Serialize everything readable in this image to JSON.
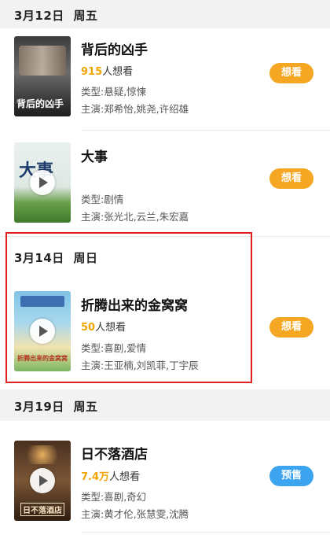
{
  "sections": [
    {
      "date": "3月12日",
      "weekday": "周五",
      "movies": [
        {
          "title": "背后的凶手",
          "want_count": "915",
          "want_suffix": "人想看",
          "genre": "类型:悬疑,惊悚",
          "cast": "主演:郑希怡,姚尧,许绍雄",
          "button": "想看",
          "poster_text": "背后的凶手",
          "has_play": false
        },
        {
          "title": "大事",
          "want_count": "",
          "want_suffix": "",
          "genre": "类型:剧情",
          "cast": "主演:张光北,云兰,朱宏嘉",
          "button": "想看",
          "poster_text": "大事",
          "has_play": true
        }
      ]
    },
    {
      "date": "3月14日",
      "weekday": "周日",
      "movies": [
        {
          "title": "折腾出来的金窝窝",
          "want_count": "50",
          "want_suffix": "人想看",
          "genre": "类型:喜剧,爱情",
          "cast": "主演:王亚楠,刘凯菲,丁宇辰",
          "button": "想看",
          "poster_text": "折腾出来的金窝窝",
          "has_play": true
        }
      ]
    },
    {
      "date": "3月19日",
      "weekday": "周五",
      "movies": [
        {
          "title": "日不落酒店",
          "want_count": "7.4万",
          "want_suffix": "人想看",
          "genre": "类型:喜剧,奇幻",
          "cast": "主演:黄才伦,张慧雯,沈腾",
          "button": "预售",
          "poster_text": "日不落酒店",
          "has_play": true
        }
      ]
    }
  ],
  "colors": {
    "want_button": "#f5a623",
    "presale_button": "#3da5f0",
    "want_count": "#f0a500",
    "highlight_border": "#e02020"
  }
}
